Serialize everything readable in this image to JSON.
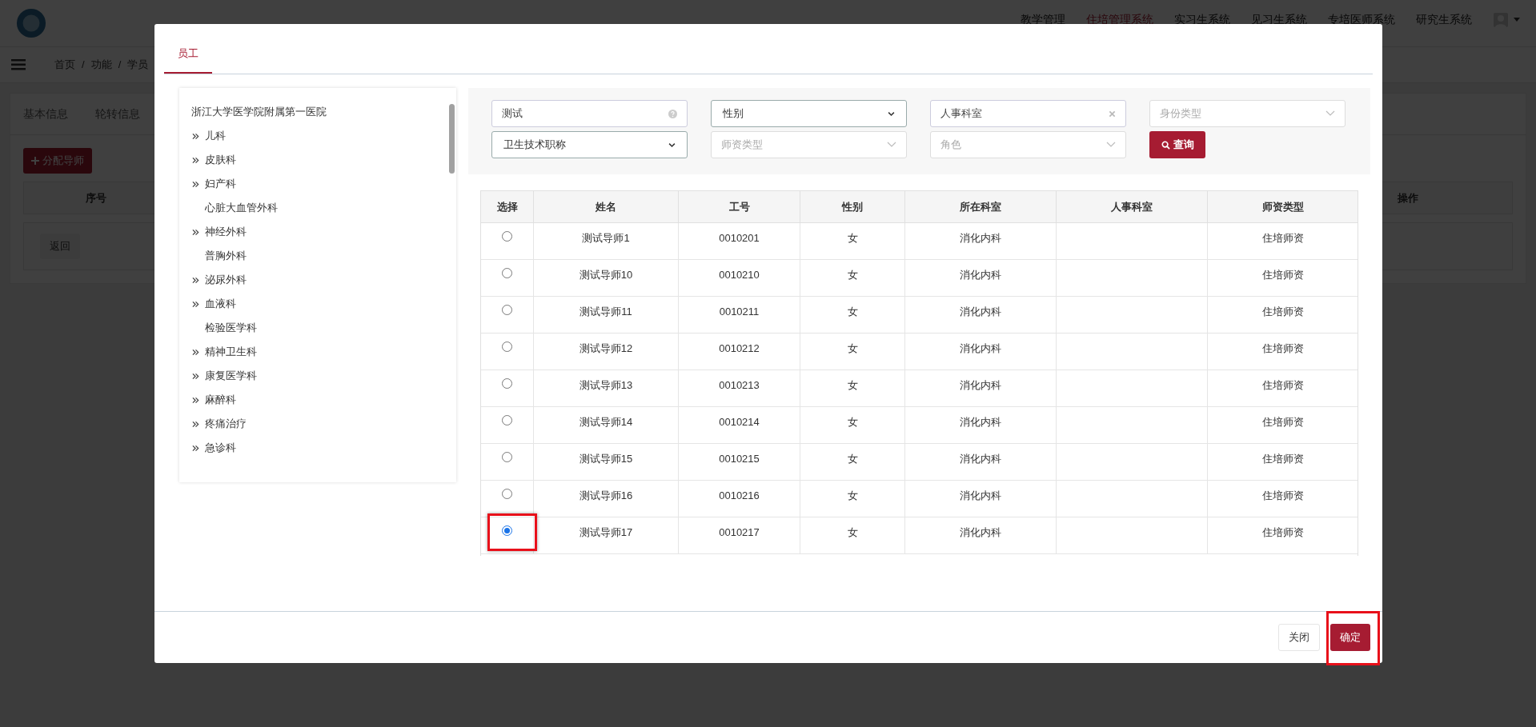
{
  "page": {
    "nav": [
      {
        "label": "教学管理",
        "selected": false
      },
      {
        "label": "住培管理系统",
        "selected": true
      },
      {
        "label": "实习生系统",
        "selected": false
      },
      {
        "label": "见习生系统",
        "selected": false
      },
      {
        "label": "专培医师系统",
        "selected": false
      },
      {
        "label": "研究生系统",
        "selected": false
      }
    ],
    "breadcrumb": [
      "首页",
      "功能",
      "学员"
    ],
    "breadcrumb_separator": "/",
    "tabs": [
      {
        "label": "基本信息",
        "selected": false
      },
      {
        "label": "轮转信息",
        "selected": false
      }
    ],
    "assign_button": "分配导师",
    "columns": [
      "序号",
      "操作"
    ],
    "back_button": "返回"
  },
  "dialog": {
    "tabs": [
      {
        "label": "员工",
        "selected": true
      }
    ],
    "tree": {
      "root": "浙江大学医学院附属第一医院",
      "items": [
        {
          "label": "儿科",
          "expandable": true
        },
        {
          "label": "皮肤科",
          "expandable": true
        },
        {
          "label": "妇产科",
          "expandable": true
        },
        {
          "label": "心脏大血管外科",
          "expandable": false
        },
        {
          "label": "神经外科",
          "expandable": true
        },
        {
          "label": "普胸外科",
          "expandable": false
        },
        {
          "label": "泌尿外科",
          "expandable": true
        },
        {
          "label": "血液科",
          "expandable": true
        },
        {
          "label": "检验医学科",
          "expandable": false
        },
        {
          "label": "精神卫生科",
          "expandable": true
        },
        {
          "label": "康复医学科",
          "expandable": true
        },
        {
          "label": "麻醉科",
          "expandable": true
        },
        {
          "label": "疼痛治疗",
          "expandable": true
        },
        {
          "label": "急诊科",
          "expandable": true
        }
      ]
    },
    "filters": [
      {
        "kind": "help",
        "value": "测试"
      },
      {
        "kind": "select",
        "value": "性别"
      },
      {
        "kind": "clearable",
        "value": "人事科室"
      },
      {
        "kind": "dropdown",
        "placeholder": "身份类型"
      },
      {
        "kind": "select",
        "value": "卫生技术职称"
      },
      {
        "kind": "dropdown",
        "placeholder": "师资类型"
      },
      {
        "kind": "dropdown",
        "placeholder": "角色"
      }
    ],
    "search_button": "查询",
    "table": {
      "columns": [
        "选择",
        "姓名",
        "工号",
        "性别",
        "所在科室",
        "人事科室",
        "师资类型"
      ],
      "rows": [
        {
          "selected": false,
          "highlighted": false,
          "name": "测试导师1",
          "id": "0010201",
          "gender": "女",
          "department": "消化内科",
          "teacher_type": "住培师资"
        },
        {
          "selected": false,
          "highlighted": false,
          "name": "测试导师10",
          "id": "0010210",
          "gender": "女",
          "department": "消化内科",
          "teacher_type": "住培师资"
        },
        {
          "selected": false,
          "highlighted": false,
          "name": "测试导师11",
          "id": "0010211",
          "gender": "女",
          "department": "消化内科",
          "teacher_type": "住培师资"
        },
        {
          "selected": false,
          "highlighted": false,
          "name": "测试导师12",
          "id": "0010212",
          "gender": "女",
          "department": "消化内科",
          "teacher_type": "住培师资"
        },
        {
          "selected": false,
          "highlighted": false,
          "name": "测试导师13",
          "id": "0010213",
          "gender": "女",
          "department": "消化内科",
          "teacher_type": "住培师资"
        },
        {
          "selected": false,
          "highlighted": false,
          "name": "测试导师14",
          "id": "0010214",
          "gender": "女",
          "department": "消化内科",
          "teacher_type": "住培师资"
        },
        {
          "selected": false,
          "highlighted": false,
          "name": "测试导师15",
          "id": "0010215",
          "gender": "女",
          "department": "消化内科",
          "teacher_type": "住培师资"
        },
        {
          "selected": false,
          "highlighted": false,
          "name": "测试导师16",
          "id": "0010216",
          "gender": "女",
          "department": "消化内科",
          "teacher_type": "住培师资"
        },
        {
          "selected": true,
          "highlighted": true,
          "name": "测试导师17",
          "id": "0010217",
          "gender": "女",
          "department": "消化内科",
          "teacher_type": "住培师资"
        }
      ]
    },
    "close_button": "关闭",
    "confirm_button": {
      "label": "确定",
      "highlighted": true
    }
  }
}
